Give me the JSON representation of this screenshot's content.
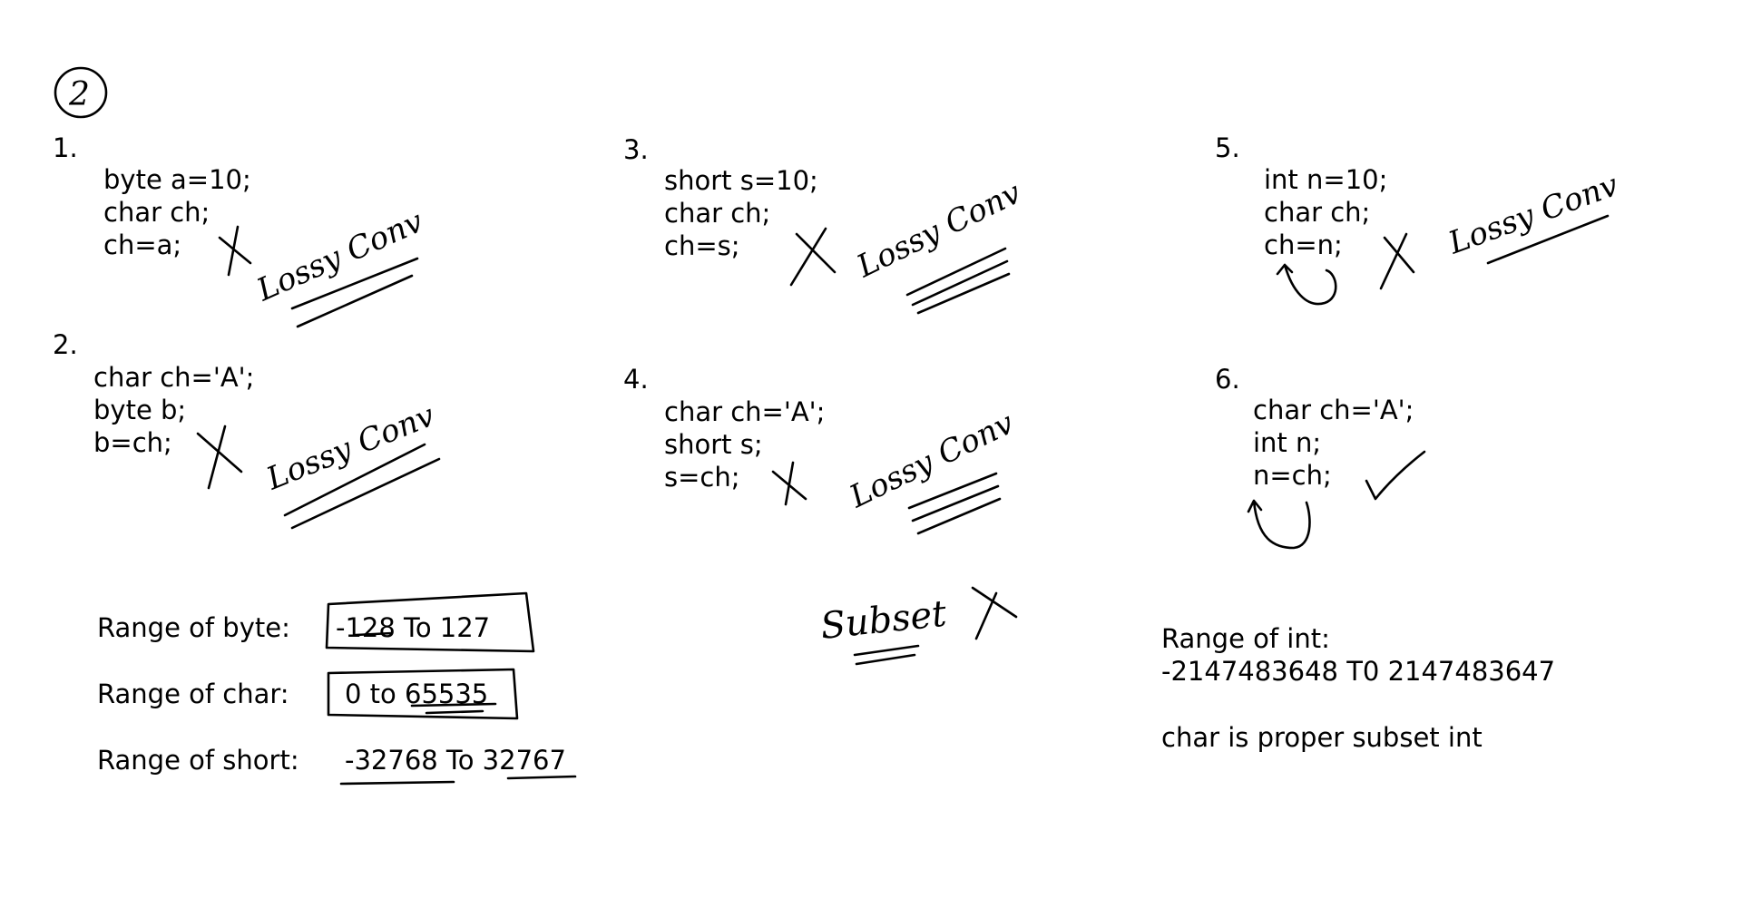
{
  "page": {
    "marker": "2"
  },
  "examples": [
    {
      "number": "1.",
      "lines": [
        "byte a=10;",
        "char ch;",
        "ch=a;"
      ],
      "verdict": "invalid",
      "note": "Lossy Conv"
    },
    {
      "number": "2.",
      "lines": [
        "char ch='A';",
        "byte b;",
        "b=ch;"
      ],
      "verdict": "invalid",
      "note": "Lossy Conv"
    },
    {
      "number": "3.",
      "lines": [
        "short s=10;",
        "char ch;",
        "ch=s;"
      ],
      "verdict": "invalid",
      "note": "Lossy Conv"
    },
    {
      "number": "4.",
      "lines": [
        "char ch='A';",
        "short s;",
        "s=ch;"
      ],
      "verdict": "invalid",
      "note": "Lossy Conv"
    },
    {
      "number": "5.",
      "lines": [
        "int n=10;",
        "char ch;",
        "ch=n;"
      ],
      "verdict": "invalid",
      "note": "Lossy Conv"
    },
    {
      "number": "6.",
      "lines": [
        "char ch='A';",
        "int n;",
        "n=ch;"
      ],
      "verdict": "valid",
      "note": ""
    }
  ],
  "ranges": {
    "byte_label": "Range of byte:",
    "byte_value": "-128 To 127",
    "char_label": "Range of char:",
    "char_value": "0 to 65535",
    "short_label": "Range of short:",
    "short_value": "-32768 To 32767"
  },
  "subset_note": "Subset",
  "int_info": {
    "label": "Range of int:",
    "value": "-2147483648 T0 2147483647",
    "note": "char is proper subset int"
  }
}
